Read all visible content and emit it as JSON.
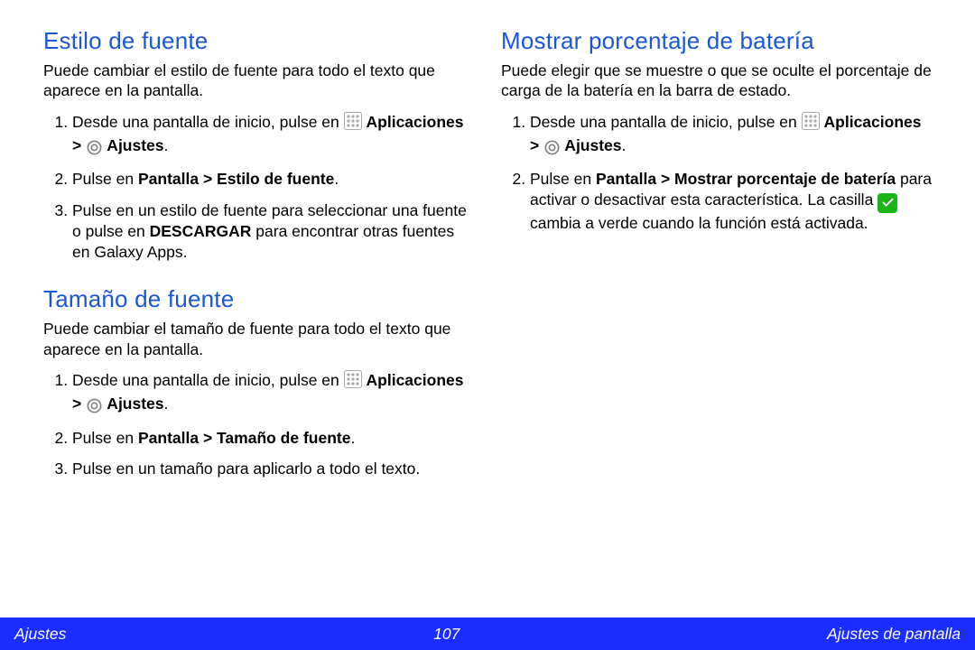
{
  "left": {
    "section1": {
      "heading": "Estilo de fuente",
      "intro": "Puede cambiar el estilo de fuente para todo el texto que aparece en la pantalla.",
      "step1_a": "Desde una pantalla de inicio, pulse en ",
      "step1_b": "Aplicaciones > ",
      "step1_c": " Ajustes",
      "step1_d": ".",
      "step2_a": "Pulse en ",
      "step2_b": "Pantalla > Estilo de fuente",
      "step2_c": ".",
      "step3_a": "Pulse en un estilo de fuente para seleccionar una fuente o pulse en ",
      "step3_b": "DESCARGAR",
      "step3_c": " para encontrar otras fuentes en Galaxy Apps."
    },
    "section2": {
      "heading": "Tamaño de fuente",
      "intro": "Puede cambiar el tamaño de fuente para todo el texto que aparece en la pantalla.",
      "step1_a": "Desde una pantalla de inicio, pulse en ",
      "step1_b": "Aplicaciones > ",
      "step1_c": " Ajustes",
      "step1_d": ".",
      "step2_a": "Pulse en ",
      "step2_b": "Pantalla > Tamaño de fuente",
      "step2_c": ".",
      "step3": "Pulse en un tamaño para aplicarlo a todo el texto."
    }
  },
  "right": {
    "section1": {
      "heading": "Mostrar porcentaje de batería",
      "intro": "Puede elegir que se muestre o que se oculte el porcentaje de carga de la batería en la barra de estado.",
      "step1_a": "Desde una pantalla de inicio, pulse en ",
      "step1_b": "Aplicaciones > ",
      "step1_c": " Ajustes",
      "step1_d": ".",
      "step2_a": "Pulse en ",
      "step2_b": "Pantalla > Mostrar porcentaje de batería",
      "step2_c": " para activar o desactivar esta característica. La casilla ",
      "step2_d": " cambia a verde cuando la función está activada."
    }
  },
  "footer": {
    "left": "Ajustes",
    "page": "107",
    "right": "Ajustes de pantalla"
  }
}
